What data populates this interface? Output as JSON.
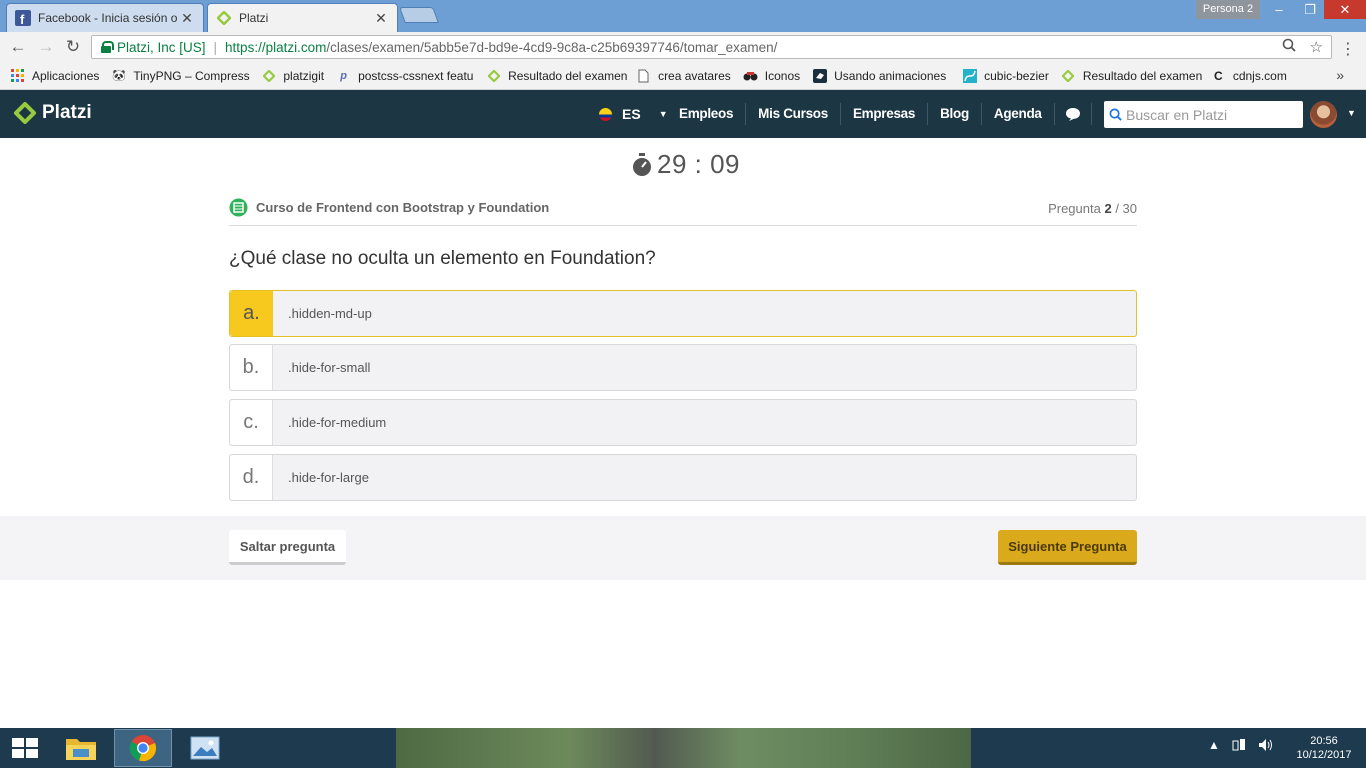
{
  "browser": {
    "tabs": [
      {
        "title": "Facebook - Inicia sesión o regístrate",
        "active": false
      },
      {
        "title": "Platzi",
        "active": true
      }
    ],
    "profile": "Persona 2",
    "window_controls": {
      "minimize": "–",
      "maximize": "❐",
      "close": "✕"
    },
    "site_identity": "Platzi, Inc [US]",
    "url_host": "https://platzi.com",
    "url_path": "/clases/examen/5abb5e7d-bd9e-4cd9-9c8a-c25b69397746/tomar_examen/",
    "bookmarks": [
      "Aplicaciones",
      "TinyPNG – Compress",
      "platzigit",
      "postcss-cssnext featu",
      "Resultado del examen",
      "crea avatares",
      "Iconos",
      "Usando animaciones",
      "cubic-bezier",
      "Resultado del examen",
      "cdnjs.com"
    ],
    "bookmarks_more": "»"
  },
  "header": {
    "logo": "Platzi",
    "language": "ES",
    "nav": [
      "Empleos",
      "Mis Cursos",
      "Empresas",
      "Blog",
      "Agenda"
    ],
    "search_placeholder": "Buscar en Platzi"
  },
  "exam": {
    "timer": "29 : 09",
    "course": "Curso de Frontend con Bootstrap y Foundation",
    "question_label": "Pregunta",
    "question_current": "2",
    "question_total": " / 30",
    "question": "¿Qué clase no oculta un elemento en Foundation?",
    "answers": [
      {
        "letter": "a.",
        "text": ".hidden-md-up",
        "selected": true
      },
      {
        "letter": "b.",
        "text": ".hide-for-small",
        "selected": false
      },
      {
        "letter": "c.",
        "text": ".hide-for-medium",
        "selected": false
      },
      {
        "letter": "d.",
        "text": ".hide-for-large",
        "selected": false
      }
    ],
    "skip_label": "Saltar pregunta",
    "next_label": "Siguiente Pregunta"
  },
  "taskbar": {
    "time": "20:56",
    "date": "10/12/2017"
  },
  "colors": {
    "header_bg": "#1c3643",
    "brand_green": "#98ca3f",
    "selected_answer": "#f7c81e",
    "next_button": "#dbaa1c"
  }
}
